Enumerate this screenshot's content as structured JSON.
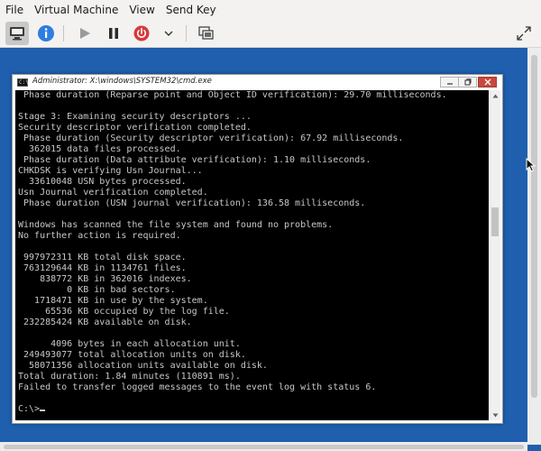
{
  "menu": [
    "File",
    "Virtual Machine",
    "View",
    "Send Key"
  ],
  "toolbar": {
    "icons": [
      "display-icon",
      "info-icon",
      "play-icon",
      "pause-icon",
      "power-icon",
      "chevron-down-icon",
      "screenshot-icon",
      "fullscreen-icon"
    ],
    "colors": {
      "info": "#2f7de1",
      "power": "#d63a3a"
    }
  },
  "window": {
    "title": "Administrator: X:\\windows\\SYSTEM32\\cmd.exe",
    "icon_glyph": "C:\\"
  },
  "console": {
    "lines": [
      " Phase duration (Reparse point and Object ID verification): 29.70 milliseconds.",
      "",
      "Stage 3: Examining security descriptors ...",
      "Security descriptor verification completed.",
      " Phase duration (Security descriptor verification): 67.92 milliseconds.",
      "  362015 data files processed.",
      " Phase duration (Data attribute verification): 1.10 milliseconds.",
      "CHKDSK is verifying Usn Journal...",
      "  33610048 USN bytes processed.",
      "Usn Journal verification completed.",
      " Phase duration (USN journal verification): 136.58 milliseconds.",
      "",
      "Windows has scanned the file system and found no problems.",
      "No further action is required.",
      "",
      " 997972311 KB total disk space.",
      " 763129644 KB in 1134761 files.",
      "    838772 KB in 362016 indexes.",
      "         0 KB in bad sectors.",
      "   1718471 KB in use by the system.",
      "     65536 KB occupied by the log file.",
      " 232285424 KB available on disk.",
      "",
      "      4096 bytes in each allocation unit.",
      " 249493077 total allocation units on disk.",
      "  58071356 allocation units available on disk.",
      "Total duration: 1.84 minutes (110891 ms).",
      "Failed to transfer logged messages to the event log with status 6.",
      "",
      "C:\\>"
    ]
  },
  "colors": {
    "desktop": "#1f5fae",
    "console_bg": "#000000",
    "console_text": "#c8c8c8"
  }
}
